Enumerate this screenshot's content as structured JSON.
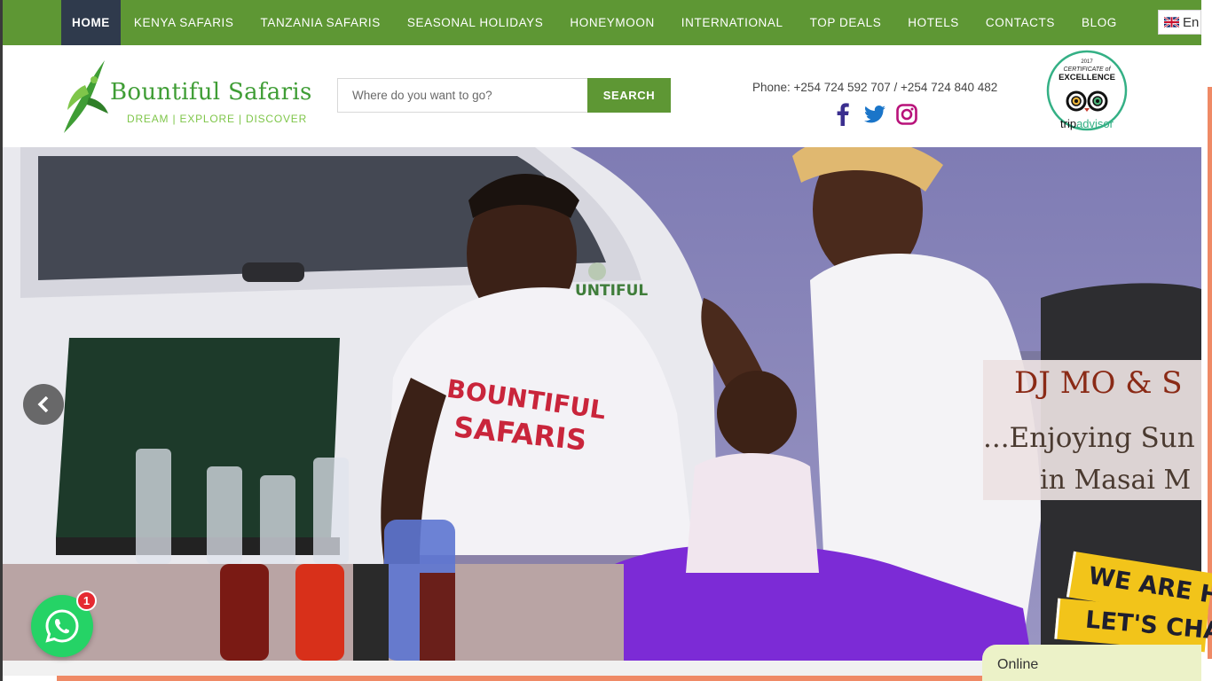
{
  "nav": {
    "items": [
      {
        "label": "HOME",
        "active": true
      },
      {
        "label": "KENYA SAFARIS",
        "active": false
      },
      {
        "label": "TANZANIA SAFARIS",
        "active": false
      },
      {
        "label": "SEASONAL HOLIDAYS",
        "active": false
      },
      {
        "label": "HONEYMOON",
        "active": false
      },
      {
        "label": "INTERNATIONAL",
        "active": false
      },
      {
        "label": "TOP DEALS",
        "active": false
      },
      {
        "label": "HOTELS",
        "active": false
      },
      {
        "label": "CONTACTS",
        "active": false
      },
      {
        "label": "BLOG",
        "active": false
      }
    ],
    "language": {
      "label": "En",
      "flag": "uk-flag-icon"
    }
  },
  "header": {
    "logo": {
      "title": "Bountiful Safaris",
      "tagline": "DREAM | EXPLORE | DISCOVER"
    },
    "search": {
      "placeholder": "Where do you want to go?",
      "button": "SEARCH"
    },
    "phone": "Phone: +254 724 592 707 / +254 724 840 482",
    "socials": [
      "facebook-icon",
      "twitter-icon",
      "instagram-icon"
    ],
    "tripadvisor": {
      "year": "2017",
      "line1": "CERTIFICATE of",
      "line2": "EXCELLENCE",
      "brand_trip": "trip",
      "brand_advisor": "advisor"
    }
  },
  "hero": {
    "shirt_line1": "BOUNTIFUL",
    "shirt_line2": "SAFARIS",
    "van_text": "UNTIFUL",
    "caption": {
      "line1": "DJ MO & S",
      "line2": "...Enjoying Sun",
      "line3": "in Masai M"
    }
  },
  "chat": {
    "banner_line1": "WE ARE HERE",
    "banner_line2": "LET'S CHAT!",
    "status": "Online",
    "badge_count": "1"
  },
  "colors": {
    "nav_green": "#5e9734",
    "nav_active": "#2f3a4c",
    "whatsapp": "#25d366",
    "accent_orange": "#ef8a66"
  }
}
